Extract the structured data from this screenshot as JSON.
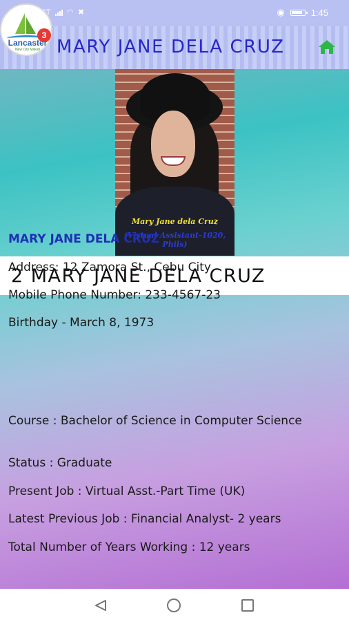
{
  "status_bar": {
    "carrier": "SMART",
    "time": "1:45"
  },
  "header": {
    "title": "MARY JANE DELA CRUZ",
    "badge_count": "3",
    "logo": {
      "name": "Lancaster",
      "tagline": "New City Makati"
    }
  },
  "photo": {
    "caption_name": "Mary Jane dela Cruz",
    "caption_role": "(Virtual Assistant-1020, Phils)"
  },
  "profile": {
    "banner": "2 MARY JANE DELA CRUZ",
    "name": "MARY JANE DELA CRUZ",
    "address": "Address: 12 Zamora St., Cebu City",
    "phone": "Mobile Phone Number: 233-4567-23",
    "birthday": "Birthday - March  8, 1973",
    "course": "Course : Bachelor of Science in Computer Science",
    "status": "Status : Graduate",
    "present_job": "Present Job : Virtual Asst.-Part Time (UK)",
    "previous_job": "Latest Previous Job : Financial Analyst- 2 years",
    "years_working": "Total Number of Years Working : 12 years"
  },
  "colors": {
    "header_title": "#2727c8",
    "home_icon": "#2fb54a",
    "name_line": "#1f2fb5",
    "badge": "#e53935"
  }
}
